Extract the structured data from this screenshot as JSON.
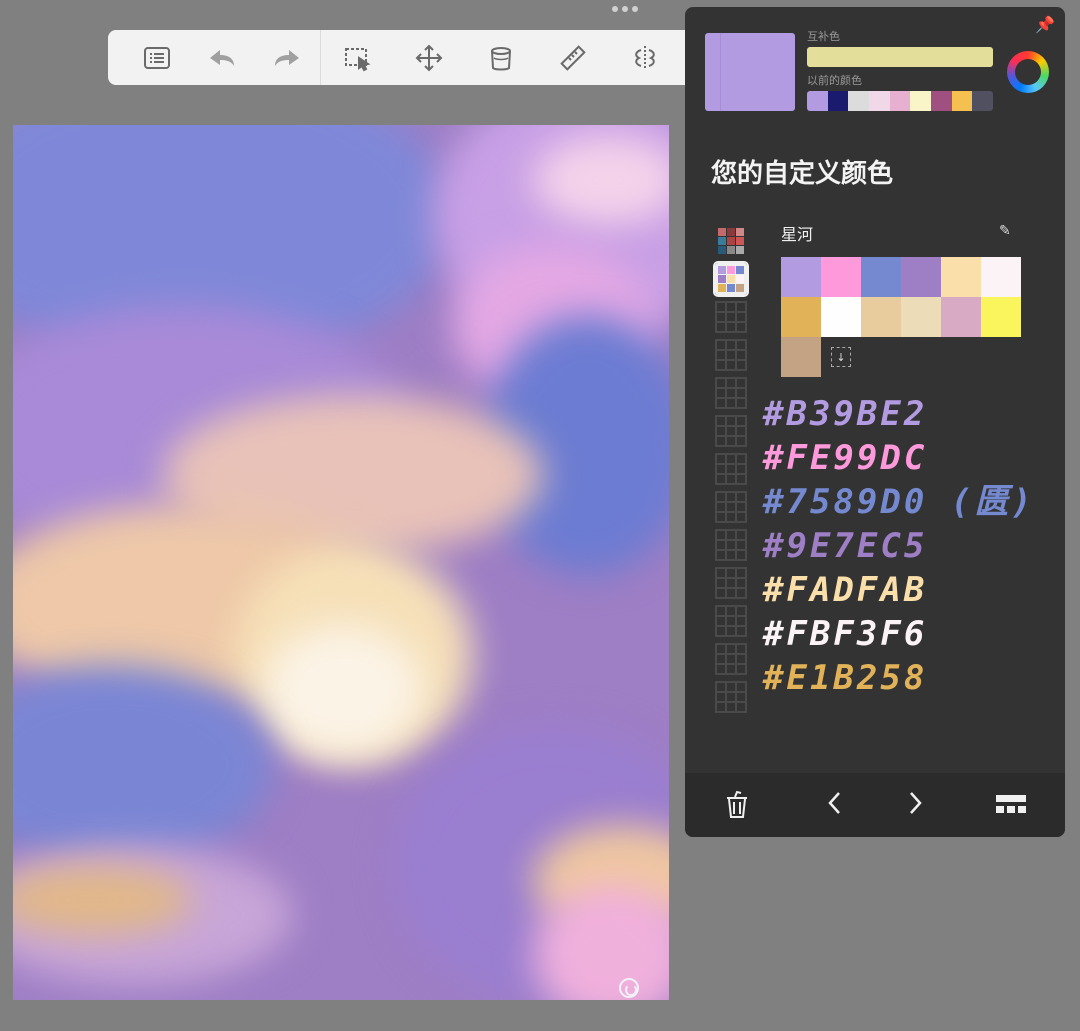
{
  "toolbar": {
    "items": [
      {
        "name": "list-icon"
      },
      {
        "name": "undo-arrow-icon"
      },
      {
        "name": "redo-arrow-icon"
      },
      {
        "name": "selection-icon"
      },
      {
        "name": "move-icon"
      },
      {
        "name": "bucket-icon"
      },
      {
        "name": "ruler-icon"
      },
      {
        "name": "symmetry-icon"
      }
    ]
  },
  "color_panel": {
    "complement_label": "互补色",
    "previous_label": "以前的颜色",
    "current_color": "#b39be2",
    "complement_color": "#e3df9b",
    "previous_colors": [
      "#b39be2",
      "#1a1a6e",
      "#dcdcdc",
      "#f0d8e8",
      "#e8b0d0",
      "#faf5c8",
      "#a05080",
      "#f5c050",
      "#505060"
    ],
    "title": "您的自定义颜色",
    "palette_name": "星河",
    "palette_swatches": [
      "#b39be2",
      "#fe99dc",
      "#7589d0",
      "#9e7ec5",
      "#fadfab",
      "#fbf3f6",
      "#e1b258",
      "#fefefe",
      "#e8cc9e",
      "#ecdcb8",
      "#d9aac4",
      "#faf55c"
    ],
    "extra_swatch": "#c4a284",
    "hex_notes": [
      {
        "text": "#B39BE2",
        "color": "#b39be2"
      },
      {
        "text": "#FE99DC",
        "color": "#fe99dc"
      },
      {
        "text": "#7589D0 (匮)",
        "color": "#7589d0"
      },
      {
        "text": "#9E7EC5",
        "color": "#9e7ec5"
      },
      {
        "text": "#FADFAB",
        "color": "#fadfab"
      },
      {
        "text": "#FBF3F6",
        "color": "#fbf3f6"
      },
      {
        "text": "#E1B258",
        "color": "#e1b258"
      }
    ]
  }
}
